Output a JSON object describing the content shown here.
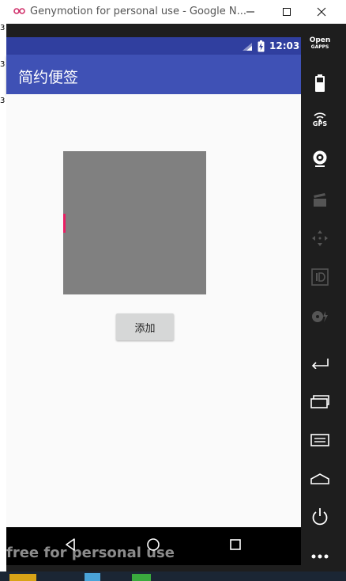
{
  "window": {
    "title": "Genymotion for personal use - Google N...",
    "edge_marks": [
      "3",
      "3",
      "3"
    ]
  },
  "status_bar": {
    "time": "12:03"
  },
  "app_bar": {
    "title": "简约便签"
  },
  "main": {
    "add_button_label": "添加"
  },
  "watermark": "free for personal use",
  "sidebar": {
    "opengapps_line1": "Open",
    "opengapps_line2": "GAPPS",
    "gps_label": "GPS"
  },
  "colors": {
    "primary": "#3f51b5",
    "primary_dark": "#303f9f",
    "accent": "#e91e63"
  }
}
